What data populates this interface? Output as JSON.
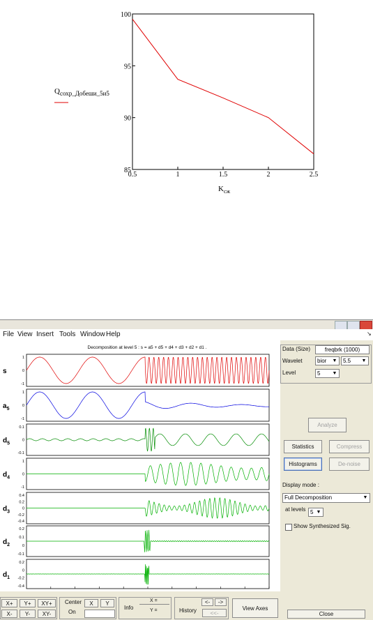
{
  "top_chart": {
    "chart_data": {
      "type": "line",
      "x": [
        0.5,
        1,
        1.5,
        2,
        2.5
      ],
      "y": [
        99.5,
        93.7,
        91.9,
        90.0,
        86.5
      ],
      "xlim": [
        0.5,
        2.5
      ],
      "ylim": [
        85,
        100
      ],
      "x_ticks": [
        "0.5",
        "1",
        "1.5",
        "2",
        "2.5"
      ],
      "y_ticks": [
        "100",
        "95",
        "90",
        "85"
      ],
      "xlabel": "K",
      "xlabel_sub": "сж",
      "legend_main": "Q",
      "legend_sub": "сохр_Добеши_5и5",
      "series_color": "#e00000",
      "grid": false
    }
  },
  "window": {
    "menu": [
      "File",
      "View",
      "Insert",
      "Tools",
      "Window",
      "Help"
    ],
    "plot_title": "Decomposition at level 5 : s = a5 + d5 + d4 + d3 + d2 + d1 .",
    "x_ticks": [
      "100",
      "200",
      "300",
      "400",
      "500",
      "600",
      "700",
      "800",
      "900",
      "1000"
    ],
    "rows": [
      {
        "label": "s",
        "sub": "",
        "ticks": [
          "1",
          "0",
          "-1"
        ],
        "color": "#e00000"
      },
      {
        "label": "a",
        "sub": "5",
        "ticks": [
          "1",
          "0",
          "-1"
        ],
        "color": "#0000e0"
      },
      {
        "label": "d",
        "sub": "5",
        "ticks": [
          "0.1",
          "0",
          "-0.1"
        ],
        "color": "#008c00"
      },
      {
        "label": "d",
        "sub": "4",
        "ticks": [
          "1",
          "0",
          "-1"
        ],
        "color": "#00b000"
      },
      {
        "label": "d",
        "sub": "3",
        "ticks": [
          "0.4",
          "0.2",
          "0",
          "-0.2",
          "-0.4"
        ],
        "color": "#00b000"
      },
      {
        "label": "d",
        "sub": "2",
        "ticks": [
          "0.2",
          "0.1",
          "0",
          "-0.1"
        ],
        "color": "#00b000"
      },
      {
        "label": "d",
        "sub": "1",
        "ticks": [
          "0.2",
          "0",
          "-0.2",
          "-0.4"
        ],
        "color": "#00b000"
      }
    ],
    "panel": {
      "data_label": "Data  (Size)",
      "data_value": "freqbrk  (1000)",
      "wavelet_label": "Wavelet",
      "wavelet_family": "bior",
      "wavelet_order": "5.5",
      "level_label": "Level",
      "level_value": "5",
      "analyze": "Analyze",
      "statistics": "Statistics",
      "compress": "Compress",
      "histograms": "Histograms",
      "denoise": "De-noise",
      "display_mode_label": "Display mode :",
      "display_mode_value": "Full Decomposition",
      "at_levels_label": "at levels",
      "at_levels_value": "5",
      "show_synth": "Show Synthesized Sig.",
      "close": "Close"
    },
    "bottom": {
      "xplus": "X+",
      "yplus": "Y+",
      "xyplus": "XY+",
      "xminus": "X-",
      "yminus": "Y-",
      "xyminus": "XY-",
      "center": "Center",
      "on": "On",
      "x": "X",
      "y": "Y",
      "info": "Info",
      "xeq": "X =",
      "yeq": "Y =",
      "history": "History",
      "hist_back": "<-",
      "hist_fwd": "->",
      "hist_first": "<<-",
      "view_axes": "View Axes"
    }
  }
}
